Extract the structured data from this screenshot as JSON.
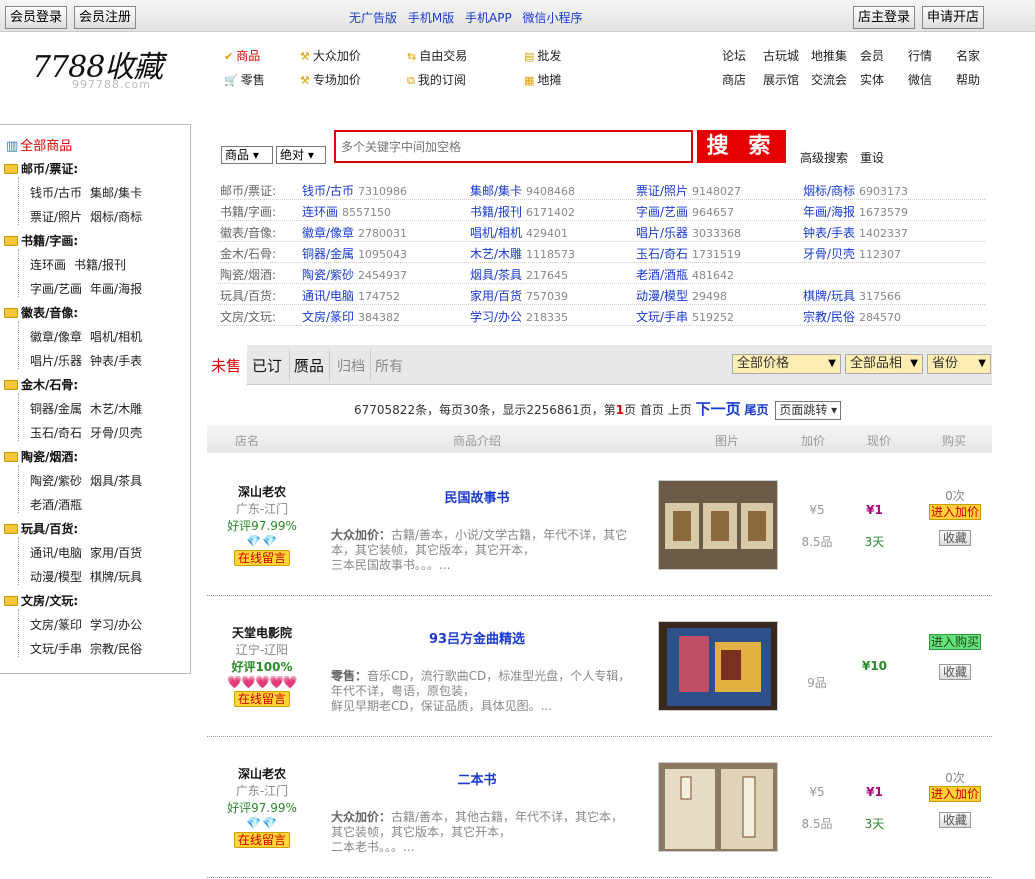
{
  "topbar": {
    "login": "会员登录",
    "register": "会员注册",
    "links": [
      "无广告版",
      "手机M版",
      "手机APP",
      "微信小程序"
    ],
    "shop_login": "店主登录",
    "open_shop": "申请开店"
  },
  "logo": {
    "main": "7788收藏",
    "sub": "997788.com"
  },
  "mainnav": [
    {
      "label": "商品",
      "icon": "check-icon"
    },
    {
      "label": "大众加价",
      "icon": "hammer-icon"
    },
    {
      "label": "自由交易",
      "icon": "exchange-icon"
    },
    {
      "label": "批发",
      "icon": "stack-icon"
    },
    {
      "label": "零售",
      "icon": "cart-icon"
    },
    {
      "label": "专场加价",
      "icon": "hammer-icon"
    },
    {
      "label": "我的订阅",
      "icon": "subscribe-icon"
    },
    {
      "label": "地摊",
      "icon": "stall-icon"
    }
  ],
  "rightnav": [
    "论坛",
    "古玩城",
    "地推集",
    "会员",
    "行情",
    "名家",
    "商店",
    "展示馆",
    "交流会",
    "实体",
    "微信",
    "帮助"
  ],
  "sidebar": {
    "all": "全部商品",
    "cats": [
      {
        "name": "邮币/票证:",
        "items": [
          [
            "钱币/古币",
            "集邮/集卡"
          ],
          [
            "票证/照片",
            "烟标/商标"
          ]
        ]
      },
      {
        "name": "书籍/字画:",
        "items": [
          [
            "连环画",
            "书籍/报刊"
          ],
          [
            "字画/艺画",
            "年画/海报"
          ]
        ]
      },
      {
        "name": "徽表/音像:",
        "items": [
          [
            "徽章/像章",
            "唱机/相机"
          ],
          [
            "唱片/乐器",
            "钟表/手表"
          ]
        ]
      },
      {
        "name": "金木/石骨:",
        "items": [
          [
            "铜器/金属",
            "木艺/木雕"
          ],
          [
            "玉石/奇石",
            "牙骨/贝壳"
          ]
        ]
      },
      {
        "name": "陶瓷/烟酒:",
        "items": [
          [
            "陶瓷/紫砂",
            "烟具/茶具"
          ],
          [
            "老酒/酒瓶",
            ""
          ]
        ]
      },
      {
        "name": "玩具/百货:",
        "items": [
          [
            "通讯/电脑",
            "家用/百货"
          ],
          [
            "动漫/模型",
            "棋牌/玩具"
          ]
        ]
      },
      {
        "name": "文房/文玩:",
        "items": [
          [
            "文房/篆印",
            "学习/办公"
          ],
          [
            "文玩/手串",
            "宗教/民俗"
          ]
        ]
      }
    ]
  },
  "search": {
    "type": "商品",
    "mode": "绝对",
    "placeholder": "多个关键字中间加空格",
    "button": "搜 索",
    "advanced": "高级搜索",
    "reset": "重设"
  },
  "catgrid": [
    {
      "label": "邮币/票证:",
      "cells": [
        [
          "钱币/古币",
          "7310986"
        ],
        [
          "集邮/集卡",
          "9408468"
        ],
        [
          "票证/照片",
          "9148027"
        ],
        [
          "烟标/商标",
          "6903173"
        ]
      ]
    },
    {
      "label": "书籍/字画:",
      "cells": [
        [
          "连环画",
          "8557150"
        ],
        [
          "书籍/报刊",
          "6171402"
        ],
        [
          "字画/艺画",
          "964657"
        ],
        [
          "年画/海报",
          "1673579"
        ]
      ]
    },
    {
      "label": "徽表/音像:",
      "cells": [
        [
          "徽章/像章",
          "2780031"
        ],
        [
          "唱机/相机",
          "429401"
        ],
        [
          "唱片/乐器",
          "3033368"
        ],
        [
          "钟表/手表",
          "1402337"
        ]
      ]
    },
    {
      "label": "金木/石骨:",
      "cells": [
        [
          "铜器/金属",
          "1095043"
        ],
        [
          "木艺/木雕",
          "1118573"
        ],
        [
          "玉石/奇石",
          "1731519"
        ],
        [
          "牙骨/贝壳",
          "112307"
        ]
      ]
    },
    {
      "label": "陶瓷/烟酒:",
      "cells": [
        [
          "陶瓷/紫砂",
          "2454937"
        ],
        [
          "烟具/茶具",
          "217645"
        ],
        [
          "老酒/酒瓶",
          "481642"
        ],
        [
          "",
          ""
        ]
      ]
    },
    {
      "label": "玩具/百货:",
      "cells": [
        [
          "通讯/电脑",
          "174752"
        ],
        [
          "家用/百货",
          "757039"
        ],
        [
          "动漫/模型",
          "29498"
        ],
        [
          "棋牌/玩具",
          "317566"
        ]
      ]
    },
    {
      "label": "文房/文玩:",
      "cells": [
        [
          "文房/篆印",
          "384382"
        ],
        [
          "学习/办公",
          "218335"
        ],
        [
          "文玩/手串",
          "519252"
        ],
        [
          "宗教/民俗",
          "284570"
        ]
      ]
    }
  ],
  "tabs": [
    "未售",
    "已订",
    "赝品",
    "归档",
    "所有"
  ],
  "filters": {
    "price": "全部价格",
    "grade": "全部品相",
    "province": "省份"
  },
  "pager": {
    "summary": "67705822条，每页30条，显示2256861页，第",
    "current": "1",
    "after": "页 首页 上页",
    "next": "下一页",
    "last": "尾页",
    "jump": "页面跳转"
  },
  "thead": [
    "店名",
    "商品介绍",
    "图片",
    "加价",
    "现价",
    "购买"
  ],
  "listings": [
    {
      "shop": "深山老农",
      "loc": "广东-江门",
      "rate": "好评97.99%",
      "badge": "💎💎",
      "badge_type": "gems",
      "msg": "在线留言",
      "title": "民国故事书",
      "desc_label": "大众加价：",
      "desc": "古籍/善本，小说/文学古籍，年代不详，其它本，其它装帧，其它版本，其它开本，",
      "desc2": "三本民国故事书。。。...",
      "inc": "¥5",
      "grade": "8.5品",
      "now": "¥1",
      "remain": "3天",
      "bids": "0次",
      "action": "进入加价",
      "action_type": "bid",
      "fav": "收藏"
    },
    {
      "shop": "天堂电影院",
      "loc": "辽宁-辽阳",
      "rate": "好评100%",
      "badge": "💗💗💗💗💗",
      "badge_type": "hearts",
      "msg": "在线留言",
      "title": "93吕方金曲精选",
      "desc_label": "零售：",
      "desc": "音乐CD，流行歌曲CD，标准型光盘，个人专辑，年代不详，粤语，原包装，",
      "desc2": "鲜见早期老CD，保证品质，具体见图。...",
      "inc": "",
      "grade": "9品",
      "now": "¥10",
      "remain": "",
      "bids": "",
      "action": "进入购买",
      "action_type": "buy",
      "fav": "收藏"
    },
    {
      "shop": "深山老农",
      "loc": "广东-江门",
      "rate": "好评97.99%",
      "badge": "💎💎",
      "badge_type": "gems",
      "msg": "在线留言",
      "title": "二本书",
      "desc_label": "大众加价：",
      "desc": "古籍/善本，其他古籍，年代不详，其它本，其它装帧，其它版本，其它开本，",
      "desc2": "二本老书。。。...",
      "inc": "¥5",
      "grade": "8.5品",
      "now": "¥1",
      "remain": "3天",
      "bids": "0次",
      "action": "进入加价",
      "action_type": "bid",
      "fav": "收藏"
    }
  ],
  "colors": {
    "accent_red": "#d00000",
    "link_blue": "#1a3bd0",
    "folder": "#f2c53d"
  }
}
